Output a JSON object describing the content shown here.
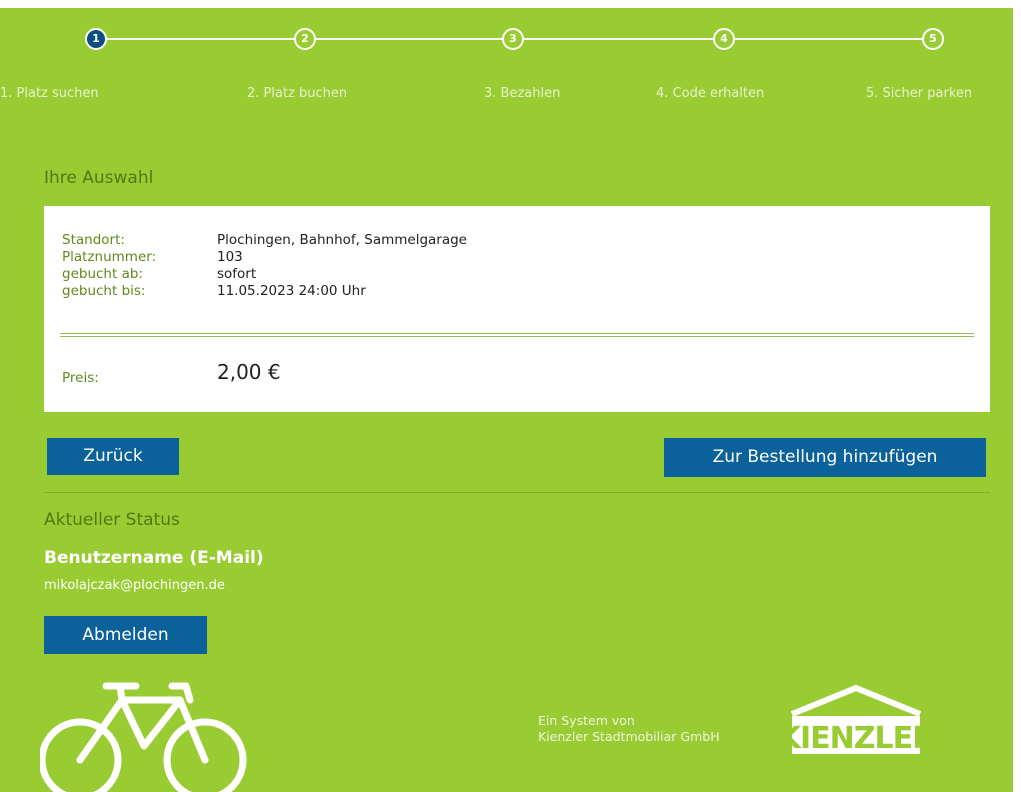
{
  "stepper": {
    "steps": [
      {
        "number": "1",
        "label": "1. Platz suchen"
      },
      {
        "number": "2",
        "label": "2. Platz buchen"
      },
      {
        "number": "3",
        "label": "3. Bezahlen"
      },
      {
        "number": "4",
        "label": "4. Code erhalten"
      },
      {
        "number": "5",
        "label": "5. Sicher parken"
      }
    ],
    "active_step": 1
  },
  "selection": {
    "title": "Ihre Auswahl",
    "rows": [
      {
        "key": "Standort:",
        "value": "Plochingen, Bahnhof, Sammelgarage"
      },
      {
        "key": "Platznummer:",
        "value": "103"
      },
      {
        "key": "gebucht ab:",
        "value": "sofort"
      },
      {
        "key": "gebucht bis:",
        "value": "11.05.2023 24:00 Uhr"
      }
    ],
    "price_label": "Preis:",
    "price_value": "2,00 €"
  },
  "actions": {
    "back_label": "Zurück",
    "add_label": "Zur Bestellung hinzufügen"
  },
  "status": {
    "title": "Aktueller Status",
    "user_label": "Benutzername (E-Mail)",
    "user_email": "mikolajczak@plochingen.de",
    "logout_label": "Abmelden"
  },
  "footer": {
    "line1": "Ein System von",
    "line2": "Kienzler Stadtmobiliar GmbH",
    "logo_text": "KIENZLER"
  },
  "colors": {
    "background": "#99cc33",
    "button": "#0b6199",
    "active_step": "#0b4f7e",
    "label_green": "#5f8a1a"
  },
  "icons": {
    "bike": "bicycle-icon",
    "logo": "kienzler-logo"
  }
}
